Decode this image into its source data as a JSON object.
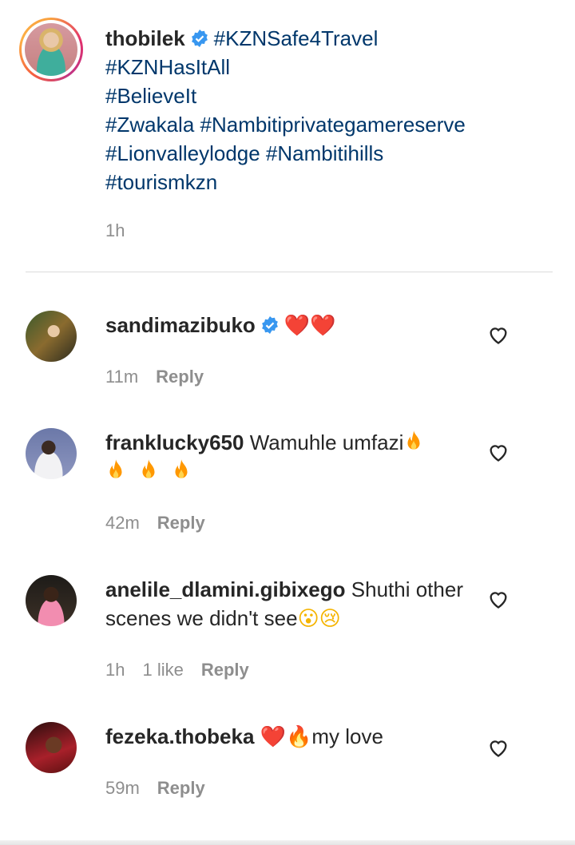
{
  "caption": {
    "username": "thobilek",
    "hashtags_first": "#KZNSafe4Travel",
    "hashtag_lines": [
      "#KZNHasItAll",
      "#BelieveIt",
      "#Zwakala #Nambitiprivategamereserve",
      "#Lionvalleylodge #Nambitihills",
      "#tourismkzn"
    ],
    "time": "1h"
  },
  "comments": [
    {
      "username": "sandimazibuko",
      "verified": true,
      "text": "",
      "emoji": "❤️❤️",
      "time": "11m",
      "likes": "",
      "reply": "Reply"
    },
    {
      "username": "franklucky650",
      "verified": false,
      "text": "Wamuhle umfazi",
      "emoji": "🔥🔥🔥🔥",
      "time": "42m",
      "likes": "",
      "reply": "Reply"
    },
    {
      "username": "anelile_dlamini.gibixego",
      "verified": false,
      "text": "Shuthi other scenes we didn't see",
      "emoji": "😮😢",
      "time": "1h",
      "likes": "1 like",
      "reply": "Reply"
    },
    {
      "username": "fezeka.thobeka",
      "verified": false,
      "text": "my love",
      "emoji": "❤️🔥",
      "time": "59m",
      "likes": "",
      "reply": "Reply"
    }
  ],
  "colors": {
    "hashtag": "#00376b",
    "verified": "#3897f0",
    "meta": "#8e8e8e",
    "heart": "#e0245e",
    "fire": "#ff9800"
  },
  "icons": {
    "like": "heart-outline-icon",
    "verified": "verified-badge-icon",
    "fire": "fire-emoji",
    "red_heart": "red-heart-emoji"
  }
}
